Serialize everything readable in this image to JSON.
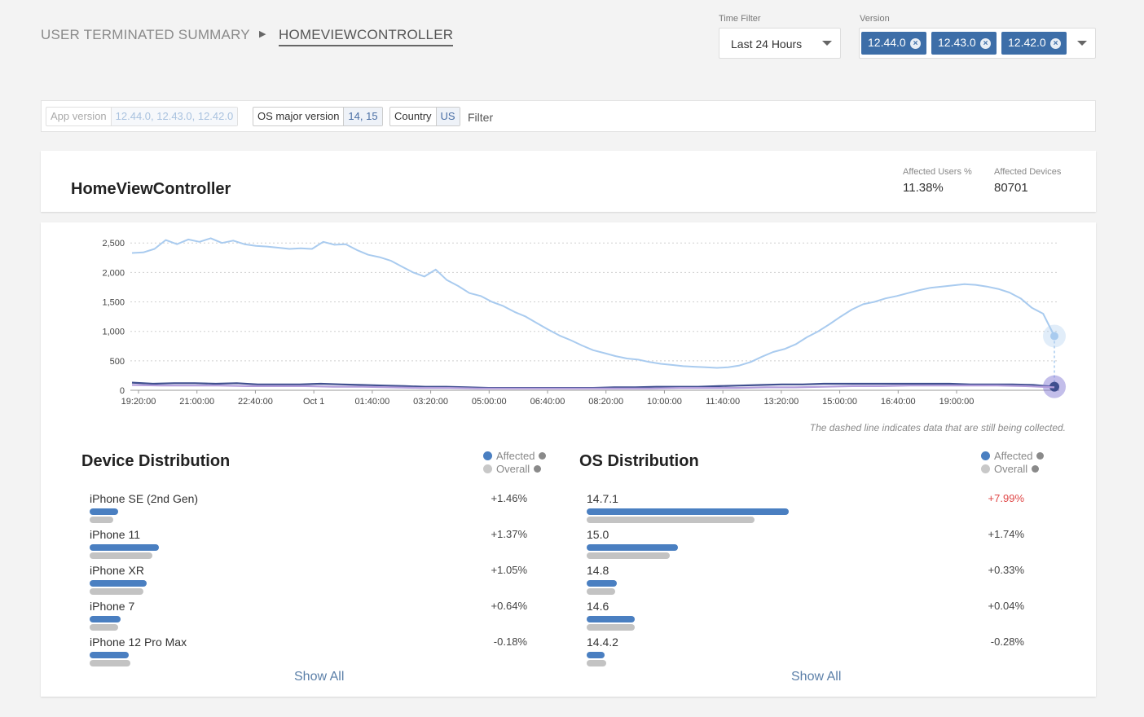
{
  "breadcrumb": {
    "root": "USER TERMINATED SUMMARY",
    "current": "HOMEVIEWCONTROLLER"
  },
  "time_filter": {
    "label": "Time Filter",
    "value": "Last 24 Hours"
  },
  "version_filter": {
    "label": "Version",
    "chips": [
      "12.44.0",
      "12.43.0",
      "12.42.0"
    ]
  },
  "filters": [
    {
      "key": "App version",
      "value": "12.44.0, 12.43.0, 12.42.0",
      "disabled": true
    },
    {
      "key": "OS major version",
      "value": "14, 15",
      "disabled": false
    },
    {
      "key": "Country",
      "value": "US",
      "disabled": false
    }
  ],
  "filter_placeholder": "Filter",
  "summary": {
    "title": "HomeViewController",
    "affected_users_label": "Affected Users %",
    "affected_users_value": "11.38%",
    "affected_devices_label": "Affected Devices",
    "affected_devices_value": "80701"
  },
  "chart_data": {
    "type": "line",
    "title": "",
    "xlabel": "",
    "ylabel": "",
    "x_ticks": [
      "19:20:00",
      "21:00:00",
      "22:40:00",
      "Oct 1",
      "01:40:00",
      "03:20:00",
      "05:00:00",
      "06:40:00",
      "08:20:00",
      "10:00:00",
      "11:40:00",
      "13:20:00",
      "15:00:00",
      "16:40:00",
      "19:00:00"
    ],
    "y_ticks": [
      0,
      500,
      1000,
      1500,
      2000,
      2500
    ],
    "y_tick_labels": [
      "0",
      "500",
      "1,000",
      "1,500",
      "2,000",
      "2,500"
    ],
    "ylim": [
      0,
      2600
    ],
    "grid": true,
    "note": "The dashed line indicates data that are still being collected.",
    "colors": {
      "overall": "#a9cbef",
      "affected": "#3f4f8f",
      "other": "#b39ddb"
    },
    "series": [
      {
        "values": [
          2330,
          2340,
          2400,
          2550,
          2480,
          2560,
          2520,
          2580,
          2500,
          2540,
          2480,
          2450,
          2440,
          2420,
          2400,
          2410,
          2400,
          2520,
          2470,
          2480,
          2380,
          2300,
          2260,
          2200,
          2100,
          2000,
          1930,
          2050,
          1870,
          1770,
          1650,
          1600,
          1500,
          1430,
          1330,
          1250,
          1140,
          1030,
          930,
          850,
          760,
          680,
          630,
          580,
          540,
          520,
          480,
          450,
          430,
          410,
          400,
          390,
          380,
          390,
          420,
          480,
          570,
          650,
          700,
          780,
          900,
          1000,
          1120,
          1250,
          1370,
          1460,
          1500,
          1560,
          1600,
          1650,
          1700,
          1740,
          1760,
          1780,
          1800,
          1790,
          1760,
          1720,
          1660,
          1560,
          1400,
          1300,
          920
        ]
      },
      {
        "values": [
          130,
          110,
          120,
          120,
          110,
          120,
          100,
          100,
          100,
          110,
          100,
          90,
          80,
          70,
          60,
          60,
          50,
          40,
          40,
          40,
          40,
          40,
          40,
          50,
          50,
          60,
          60,
          60,
          70,
          80,
          90,
          100,
          100,
          110,
          110,
          110,
          110,
          110,
          110,
          110,
          100,
          100,
          100,
          90,
          60
        ]
      },
      {
        "values": [
          90,
          80,
          80,
          80,
          70,
          70,
          70,
          60,
          60,
          50,
          40,
          40,
          30,
          30,
          30,
          30,
          30,
          30,
          30,
          40,
          40,
          40,
          50,
          50,
          60,
          70,
          70,
          80,
          80,
          80,
          80,
          70,
          50
        ]
      }
    ]
  },
  "device_distribution": {
    "title": "Device Distribution",
    "legend": {
      "affected": "Affected",
      "overall": "Overall"
    },
    "show_all": "Show All",
    "rows": [
      {
        "label": "iPhone SE (2nd Gen)",
        "affected": 2.2,
        "overall": 1.8,
        "diff": "+1.46%"
      },
      {
        "label": "iPhone 11",
        "affected": 5.3,
        "overall": 4.8,
        "diff": "+1.37%"
      },
      {
        "label": "iPhone XR",
        "affected": 4.4,
        "overall": 4.1,
        "diff": "+1.05%"
      },
      {
        "label": "iPhone 7",
        "affected": 2.4,
        "overall": 2.2,
        "diff": "+0.64%"
      },
      {
        "label": "iPhone 12 Pro Max",
        "affected": 3.0,
        "overall": 3.1,
        "diff": "-0.18%"
      }
    ]
  },
  "os_distribution": {
    "title": "OS Distribution",
    "legend": {
      "affected": "Affected",
      "overall": "Overall"
    },
    "show_all": "Show All",
    "rows": [
      {
        "label": "14.7.1",
        "affected": 15.5,
        "overall": 12.9,
        "diff": "+7.99%",
        "highlight": true
      },
      {
        "label": "15.0",
        "affected": 7.0,
        "overall": 6.4,
        "diff": "+1.74%",
        "highlight": false
      },
      {
        "label": "14.8",
        "affected": 2.3,
        "overall": 2.2,
        "diff": "+0.33%",
        "highlight": false
      },
      {
        "label": "14.6",
        "affected": 3.7,
        "overall": 3.7,
        "diff": "+0.04%",
        "highlight": false
      },
      {
        "label": "14.4.2",
        "affected": 1.4,
        "overall": 1.5,
        "diff": "-0.28%",
        "highlight": false
      }
    ]
  }
}
